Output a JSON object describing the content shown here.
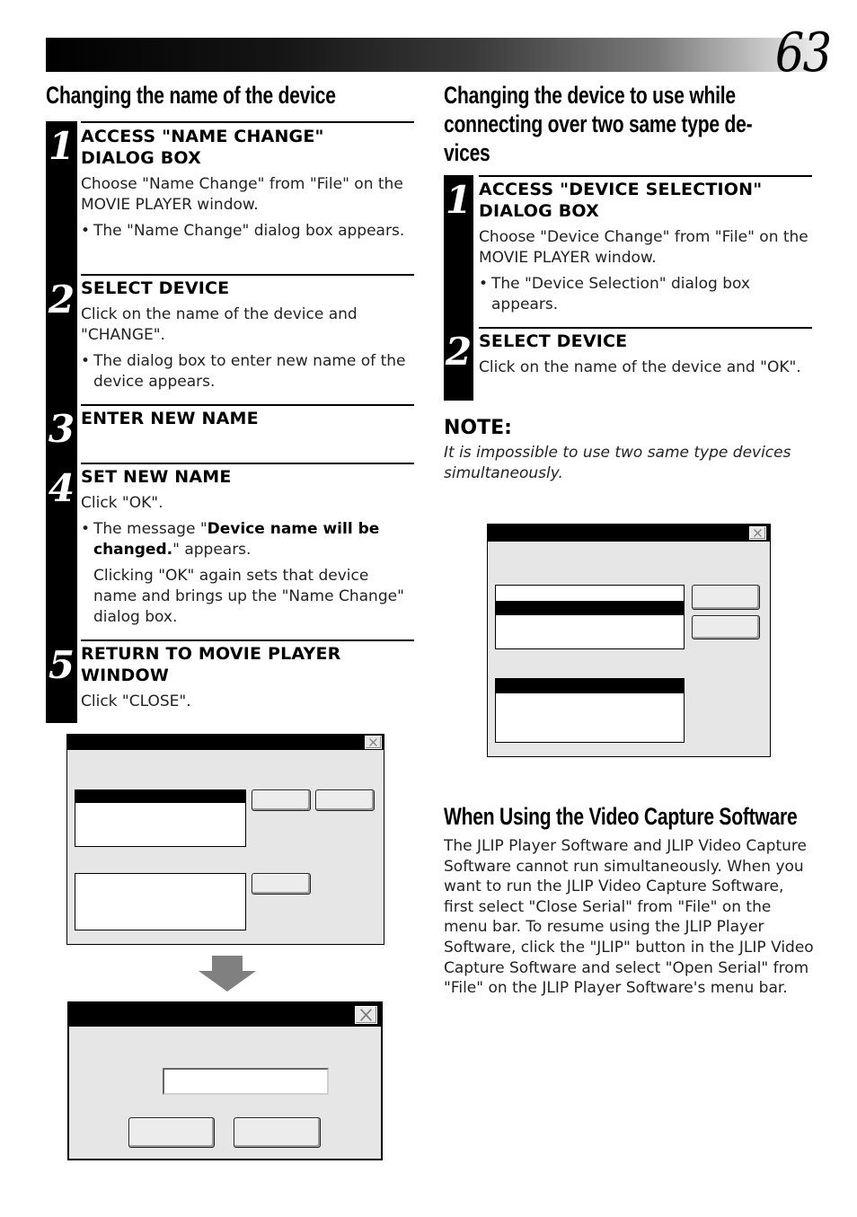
{
  "page": {
    "number": "63"
  },
  "left": {
    "title": "Changing the name of the device",
    "steps": [
      {
        "num": "1",
        "heading_l1": "ACCESS \"NAME CHANGE\"",
        "heading_l2": "DIALOG BOX",
        "text": "Choose \"Name Change\" from \"File\" on the MOVIE PLAYER window.",
        "bullet": "The \"Name Change\" dialog box appears."
      },
      {
        "num": "2",
        "heading_l1": "SELECT DEVICE",
        "text": "Click on the name of the device and \"CHANGE\".",
        "bullet": "The dialog box to enter new name of the device appears."
      },
      {
        "num": "3",
        "heading_l1": "ENTER NEW NAME"
      },
      {
        "num": "4",
        "heading_l1": "SET NEW NAME",
        "text": "Click \"OK\".",
        "bullet_pre": "The message \"",
        "bullet_bold": "Device name will be changed.",
        "bullet_post": "\" appears.",
        "continuation": "Clicking \"OK\" again sets that device name and brings up the \"Name Change\" dialog box."
      },
      {
        "num": "5",
        "heading_l1": "RETURN TO MOVIE PLAYER",
        "heading_l2": "WINDOW",
        "text": "Click \"CLOSE\"."
      }
    ]
  },
  "right": {
    "title_l1": "Changing the device to use while",
    "title_l2": "connecting over two same type de-",
    "title_l3": "vices",
    "steps": [
      {
        "num": "1",
        "heading_l1": "ACCESS \"DEVICE SELECTION\"",
        "heading_l2": "DIALOG BOX",
        "text": "Choose \"Device Change\" from \"File\" on the MOVIE PLAYER window.",
        "bullet": "The \"Device Selection\" dialog box appears."
      },
      {
        "num": "2",
        "heading_l1": "SELECT DEVICE",
        "text": "Click on the name of the device and \"OK\"."
      }
    ],
    "note": {
      "title": "NOTE:",
      "text": "It is impossible to use two same type devices simultaneously."
    },
    "video_capture": {
      "title": "When Using the Video Capture Software",
      "body": "The JLIP Player Software and JLIP Video Capture Software cannot run simultaneously. When you want to run the JLIP Video Capture Software, first select \"Close Serial\" from \"File\" on the menu bar.  To resume using the JLIP Player Software, click the \"JLIP\" button in the JLIP Video Capture Software and select \"Open Serial\" from \"File\" on the JLIP Player Software's menu bar."
    }
  },
  "icons": {
    "close": "close-x",
    "arrow": "down-arrow"
  },
  "colors": {
    "titlebar": "#000000",
    "dialog_bg": "#e6e6e6",
    "button_bg": "#ececec",
    "arrow": "#808080"
  }
}
